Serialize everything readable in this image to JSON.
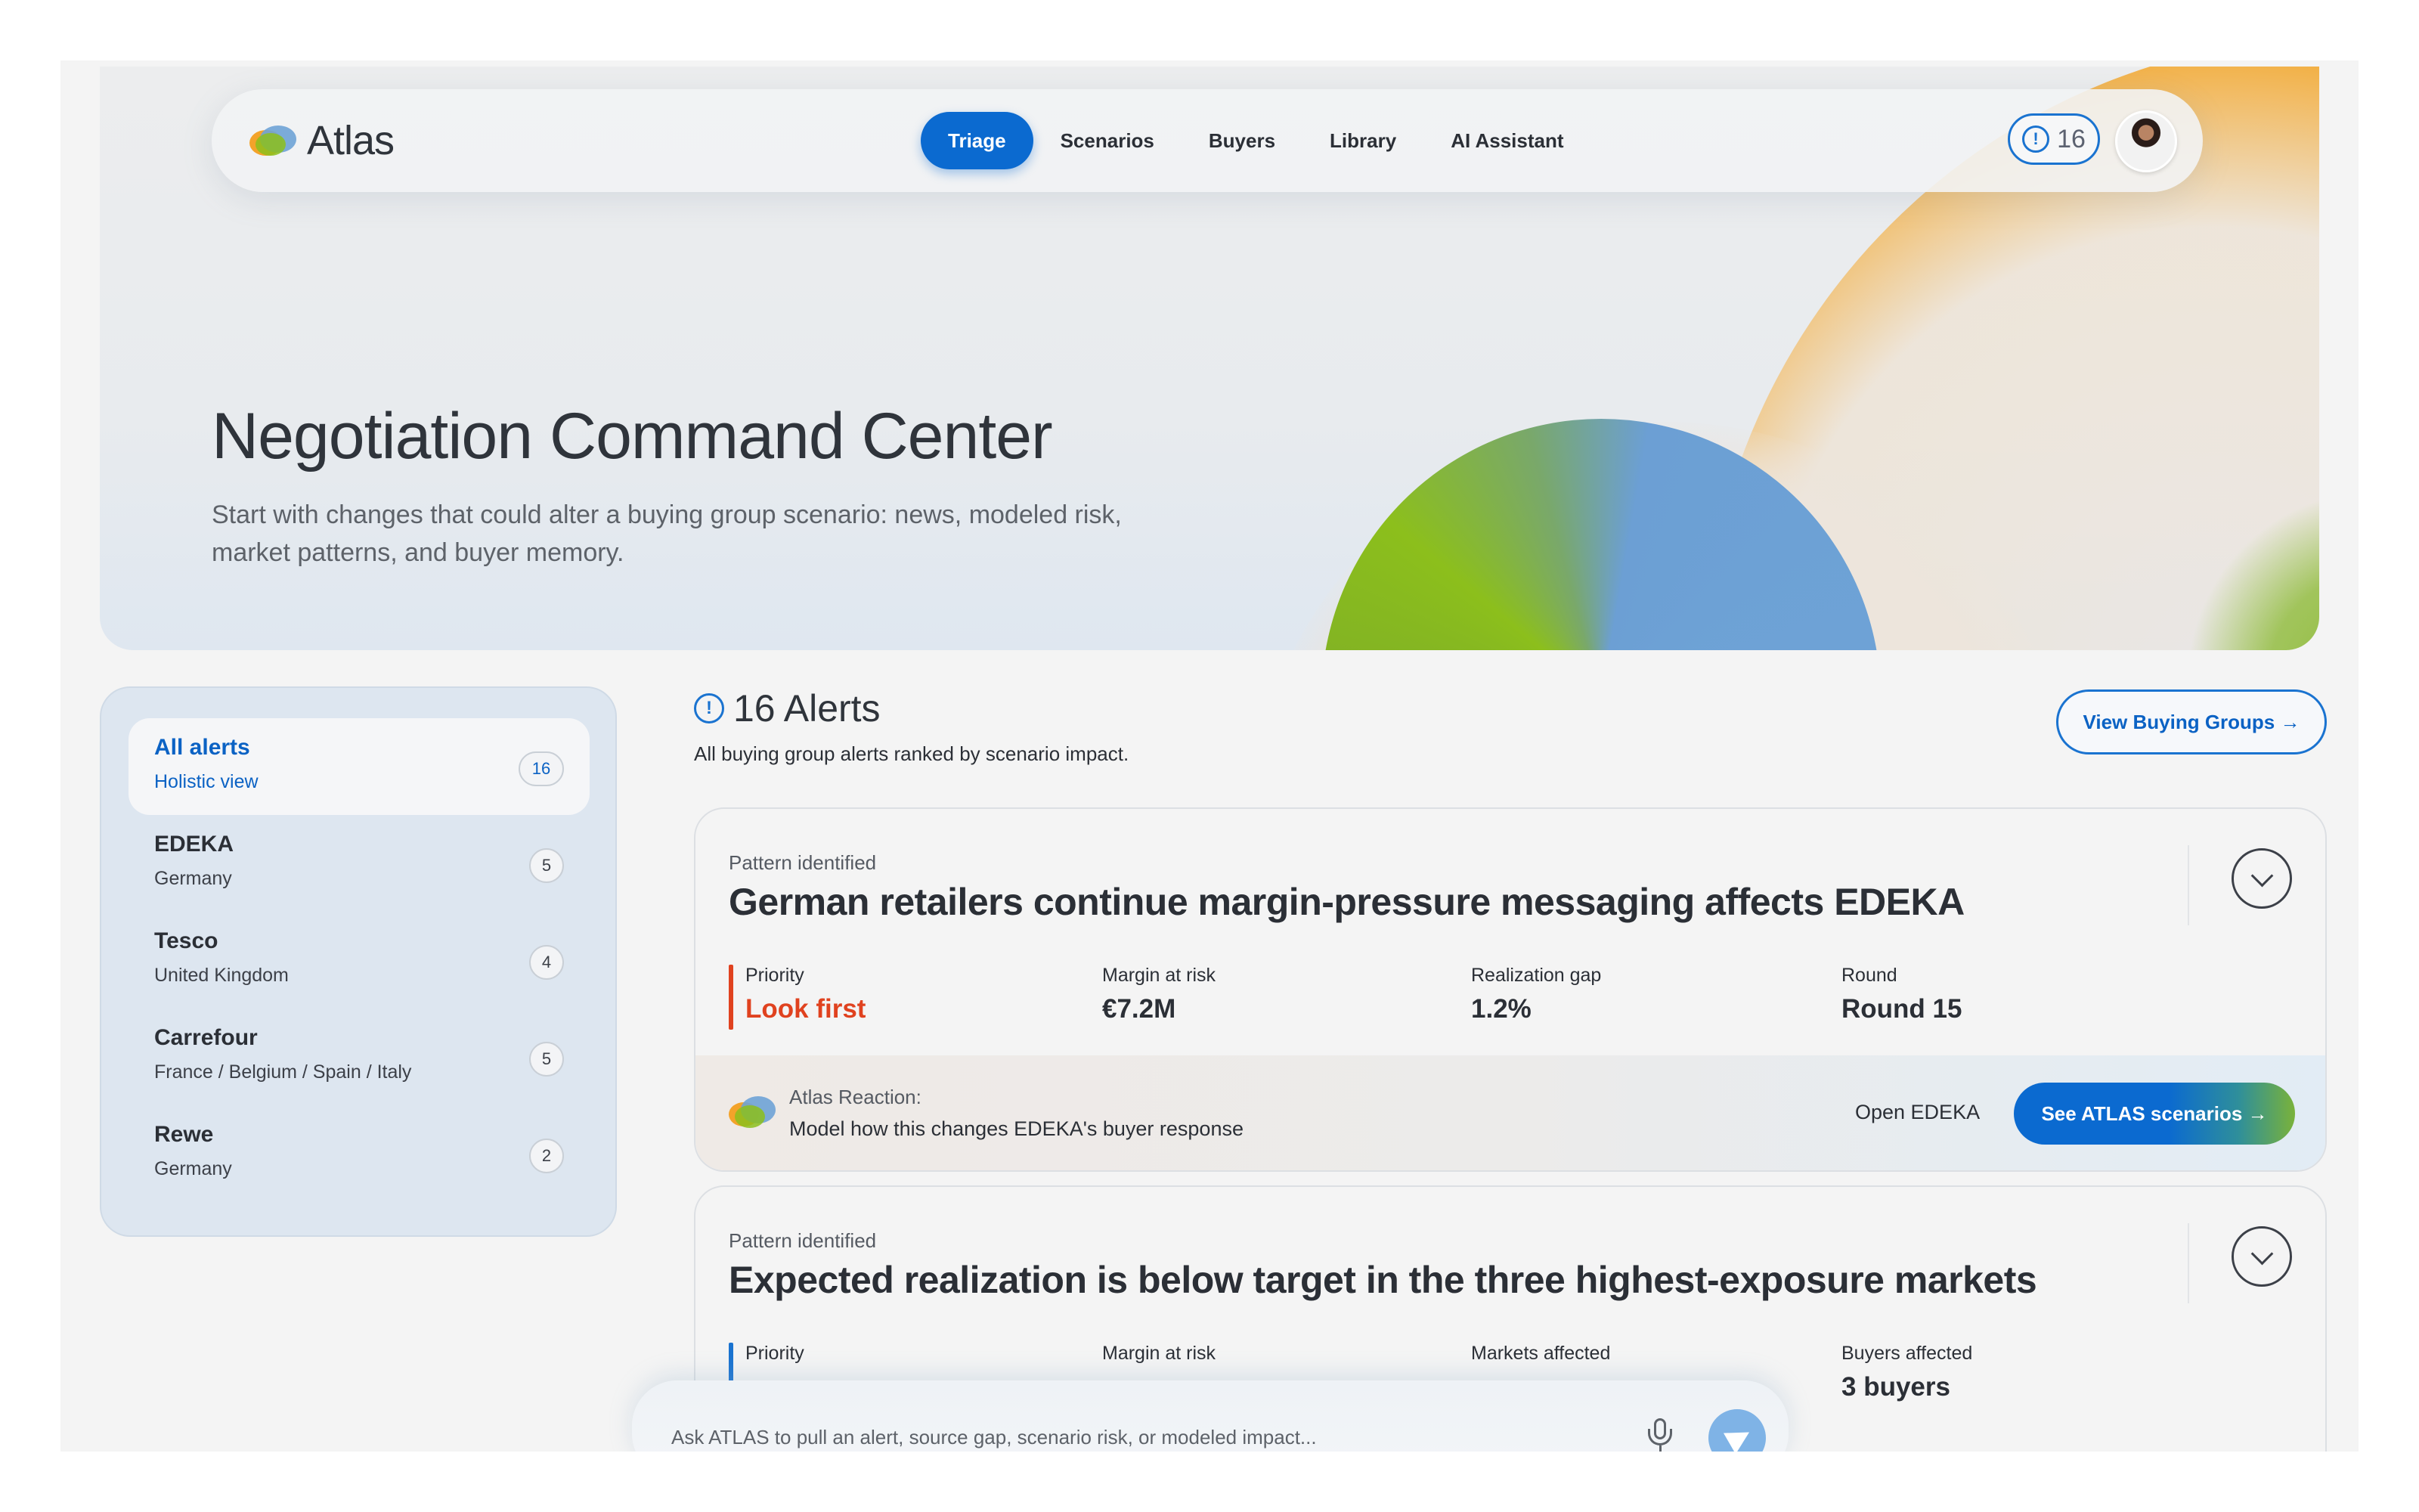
{
  "app": {
    "name": "Atlas"
  },
  "nav": {
    "tabs": [
      {
        "label": "Triage",
        "active": true
      },
      {
        "label": "Scenarios"
      },
      {
        "label": "Buyers"
      },
      {
        "label": "Library"
      },
      {
        "label": "AI Assistant"
      }
    ],
    "alert_count": "16"
  },
  "hero": {
    "title": "Negotiation Command Center",
    "subtitle": "Start with changes that could alter a buying group scenario: news, modeled risk, market patterns, and buyer memory."
  },
  "sidebar": {
    "items": [
      {
        "name": "All alerts",
        "sub": "Holistic view",
        "count": "16",
        "active": true
      },
      {
        "name": "EDEKA",
        "sub": "Germany",
        "count": "5"
      },
      {
        "name": "Tesco",
        "sub": "United Kingdom",
        "count": "4"
      },
      {
        "name": "Carrefour",
        "sub": "France / Belgium / Spain / Italy",
        "count": "5"
      },
      {
        "name": "Rewe",
        "sub": "Germany",
        "count": "2"
      }
    ]
  },
  "alerts": {
    "title": "16 Alerts",
    "subtitle": "All buying group alerts ranked by scenario impact.",
    "view_button": "View Buying Groups →"
  },
  "cards": [
    {
      "kicker": "Pattern identified",
      "title": "German retailers continue margin-pressure messaging affects EDEKA",
      "metrics": [
        {
          "label": "Priority",
          "value": "Look first"
        },
        {
          "label": "Margin at risk",
          "value": "€7.2M"
        },
        {
          "label": "Realization gap",
          "value": "1.2%"
        },
        {
          "label": "Round",
          "value": "Round 15"
        }
      ],
      "reaction_label": "Atlas Reaction:",
      "reaction_text": "Model how this changes EDEKA's buyer response",
      "open_link": "Open EDEKA",
      "cta": "See ATLAS scenarios →"
    },
    {
      "kicker": "Pattern identified",
      "title": "Expected realization is below target in the three highest-exposure markets",
      "metrics": [
        {
          "label": "Priority",
          "value": ""
        },
        {
          "label": "Margin at risk",
          "value": ""
        },
        {
          "label": "Markets affected",
          "value": ""
        },
        {
          "label": "Buyers affected",
          "value": "3 buyers"
        }
      ]
    }
  ],
  "ask": {
    "placeholder": "Ask ATLAS to pull an alert, source gap, scenario risk, or modeled impact..."
  },
  "colors": {
    "accent": "#0b6ad0",
    "priority": "#e0421f",
    "orange": "#f3a32a",
    "green": "#8cbf1c",
    "blue": "#6ea3d6"
  }
}
